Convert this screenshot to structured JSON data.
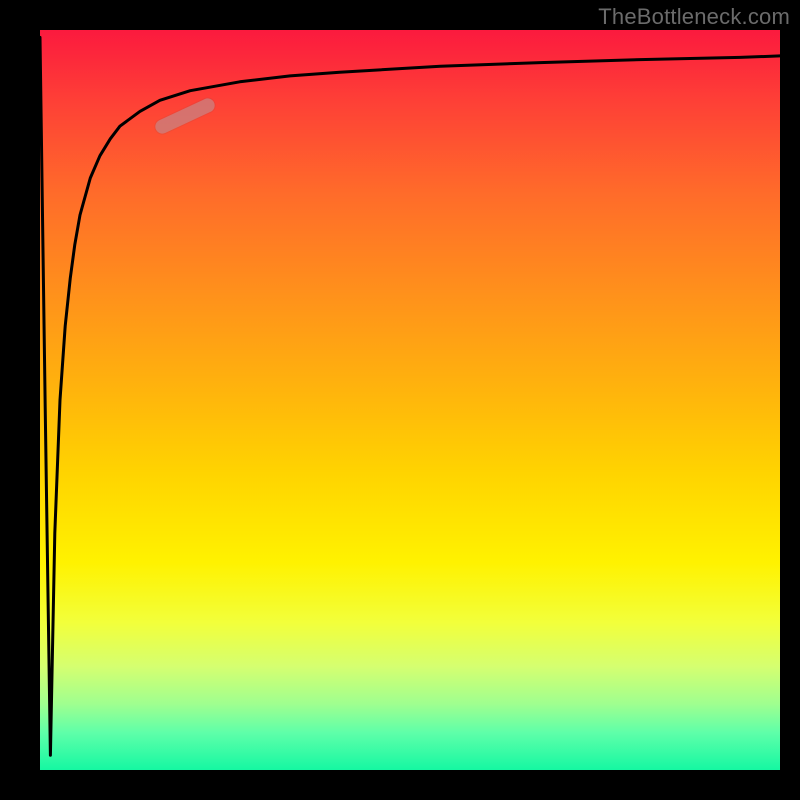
{
  "watermark": "TheBottleneck.com",
  "colors": {
    "frame": "#000000",
    "curve": "#000000",
    "marker": "rgba(200,130,130,0.75)"
  },
  "chart_data": {
    "type": "line",
    "title": "",
    "xlabel": "",
    "ylabel": "",
    "xlim": [
      0,
      100
    ],
    "ylim": [
      0,
      100
    ],
    "grid": false,
    "legend": false,
    "series": [
      {
        "name": "curve",
        "x": [
          0.0,
          0.7,
          1.4,
          2.0,
          2.7,
          3.4,
          4.1,
          4.7,
          5.4,
          6.8,
          8.1,
          9.5,
          10.8,
          13.5,
          16.2,
          20.3,
          27.0,
          33.8,
          40.5,
          54.1,
          67.6,
          81.1,
          94.6,
          100.0
        ],
        "y": [
          99.0,
          49.0,
          2.0,
          32.0,
          50.0,
          60.0,
          66.5,
          71.0,
          75.0,
          80.0,
          83.0,
          85.3,
          87.0,
          89.0,
          90.5,
          91.8,
          93.0,
          93.8,
          94.3,
          95.1,
          95.6,
          96.0,
          96.3,
          96.5
        ]
      }
    ],
    "marker": {
      "series": "curve",
      "x_center": 19.6,
      "y_center": 88.4,
      "angle_deg": -25
    }
  }
}
